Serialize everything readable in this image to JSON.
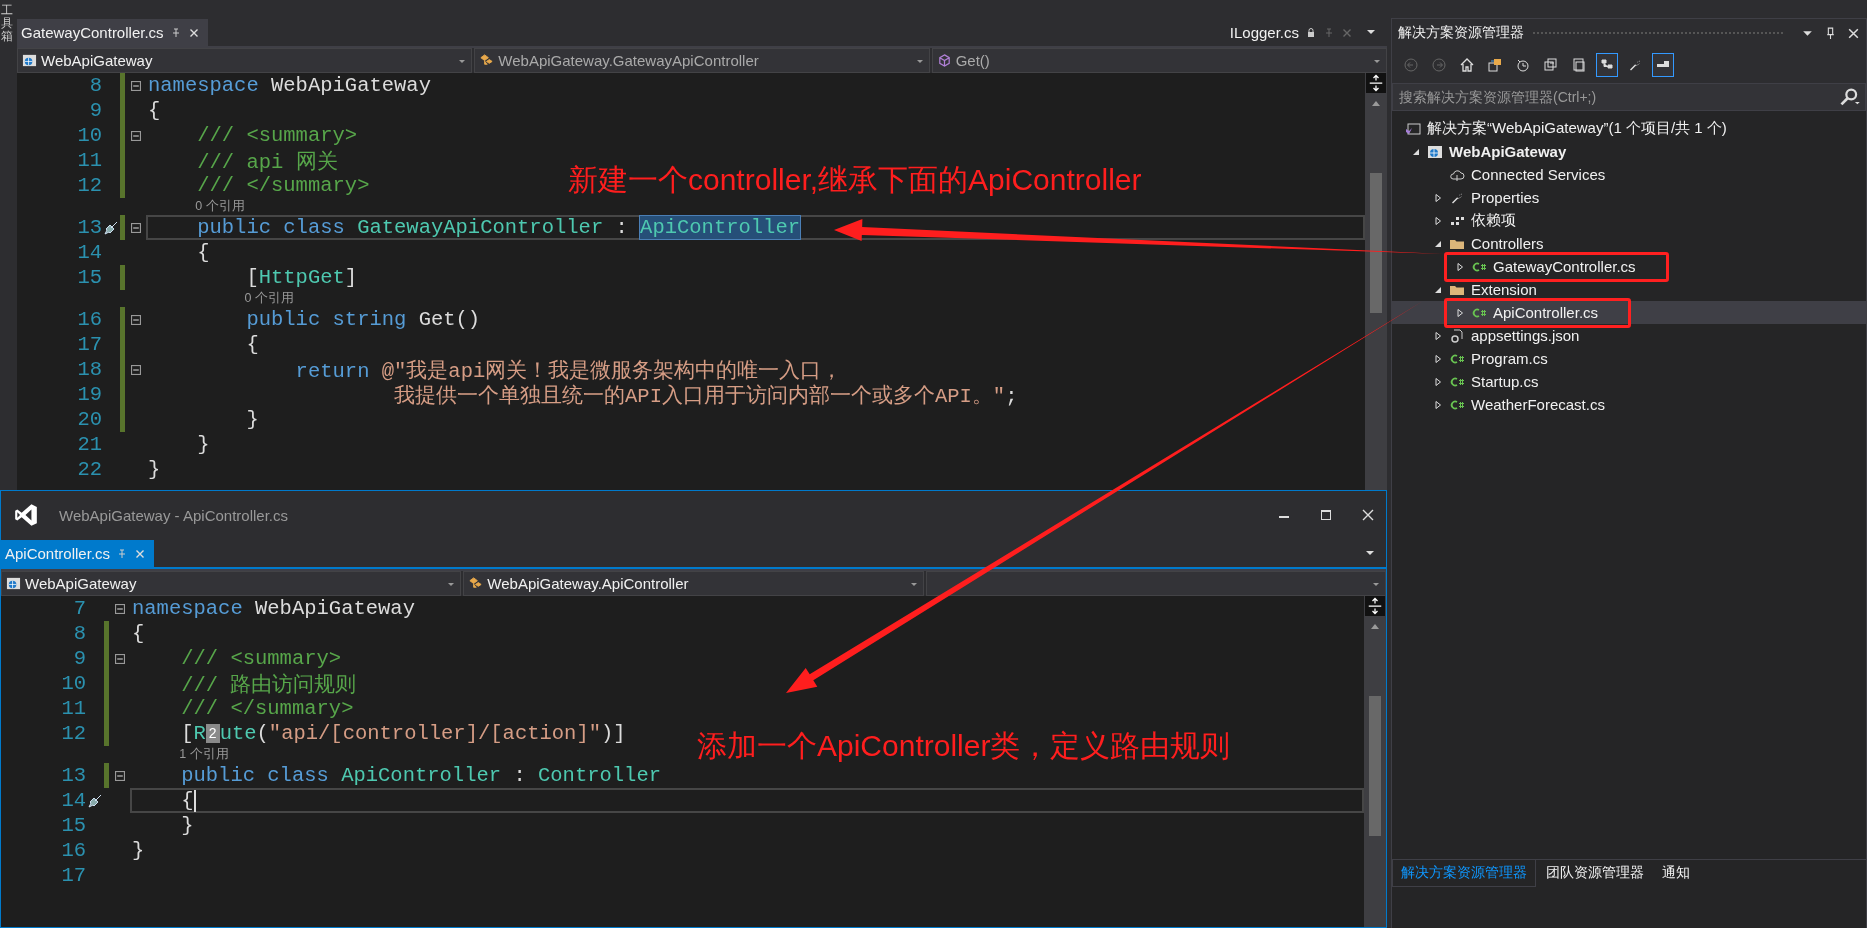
{
  "toolbox_tab": "工具箱",
  "editor": {
    "active": false,
    "tabs": [
      {
        "label": "GatewayController.cs",
        "selected": true
      }
    ],
    "side_tab": {
      "label": "ILogger.cs"
    },
    "nav": [
      {
        "kind": "project",
        "text": "WebApiGateway"
      },
      {
        "kind": "class",
        "text": "WebApiGateway.GatewayApiController"
      },
      {
        "kind": "method",
        "text": "Get()"
      }
    ],
    "lines": [
      {
        "kind": "code",
        "number": "8",
        "fold": true,
        "changed": true,
        "current": false,
        "tokens": [
          {
            "kind": "keyword",
            "text": "namespace"
          },
          {
            "kind": "plain",
            "text": " WebApiGateway"
          }
        ]
      },
      {
        "kind": "code",
        "number": "9",
        "changed": true,
        "current": false,
        "tokens": [
          {
            "kind": "plain",
            "text": "{"
          }
        ]
      },
      {
        "kind": "code",
        "number": "10",
        "fold": true,
        "changed": true,
        "current": false,
        "tokens": [
          {
            "kind": "comment",
            "text": "    /// <summary>"
          }
        ]
      },
      {
        "kind": "code",
        "number": "11",
        "changed": true,
        "current": false,
        "tokens": [
          {
            "kind": "comment",
            "text": "    /// api 网关"
          }
        ]
      },
      {
        "kind": "code",
        "number": "12",
        "changed": true,
        "current": false,
        "tokens": [
          {
            "kind": "comment",
            "text": "    /// </summary>"
          }
        ]
      },
      {
        "kind": "codelens",
        "text": "0 个引用"
      },
      {
        "kind": "code",
        "number": "13",
        "fold": true,
        "changed": true,
        "current": true,
        "quick_action": true,
        "tokens": [
          {
            "kind": "keyword",
            "text": "    public class "
          },
          {
            "kind": "type",
            "text": "GatewayApiController"
          },
          {
            "kind": "plain",
            "text": " : "
          },
          {
            "kind": "type-selected",
            "text": "ApiController"
          }
        ]
      },
      {
        "kind": "code",
        "number": "14",
        "changed": false,
        "current": false,
        "tokens": [
          {
            "kind": "plain",
            "text": "    {"
          }
        ]
      },
      {
        "kind": "code",
        "number": "15",
        "changed": true,
        "current": false,
        "tokens": [
          {
            "kind": "plain",
            "text": "        ["
          },
          {
            "kind": "type",
            "text": "HttpGet"
          },
          {
            "kind": "plain",
            "text": "]"
          }
        ]
      },
      {
        "kind": "codelens",
        "text": "0 个引用"
      },
      {
        "kind": "code",
        "number": "16",
        "fold": true,
        "changed": true,
        "current": false,
        "tokens": [
          {
            "kind": "keyword",
            "text": "        public string "
          },
          {
            "kind": "plain",
            "text": "Get()"
          }
        ]
      },
      {
        "kind": "code",
        "number": "17",
        "changed": true,
        "current": false,
        "tokens": [
          {
            "kind": "plain",
            "text": "        {"
          }
        ]
      },
      {
        "kind": "code",
        "number": "18",
        "fold": true,
        "changed": true,
        "current": false,
        "tokens": [
          {
            "kind": "keyword",
            "text": "            return "
          },
          {
            "kind": "string",
            "text": "@\"我是api网关！我是微服务架构中的唯一入口，"
          }
        ]
      },
      {
        "kind": "code",
        "number": "19",
        "changed": true,
        "current": false,
        "tokens": [
          {
            "kind": "string",
            "text": "                    我提供一个单独且统一的API入口用于访问内部一个或多个API。\""
          },
          {
            "kind": "plain",
            "text": ";"
          }
        ]
      },
      {
        "kind": "code",
        "number": "20",
        "changed": true,
        "current": false,
        "tokens": [
          {
            "kind": "plain",
            "text": "        }"
          }
        ]
      },
      {
        "kind": "code",
        "number": "21",
        "changed": false,
        "current": false,
        "tokens": [
          {
            "kind": "plain",
            "text": "    }"
          }
        ]
      },
      {
        "kind": "code",
        "number": "22",
        "changed": false,
        "current": false,
        "tokens": [
          {
            "kind": "plain",
            "text": "}"
          }
        ]
      }
    ]
  },
  "floating_window": {
    "title": "WebApiGateway - ApiController.cs",
    "active": true,
    "tabs": [
      {
        "label": "ApiController.cs",
        "selected": true
      }
    ],
    "nav": [
      {
        "kind": "project",
        "text": "WebApiGateway"
      },
      {
        "kind": "class",
        "text": "WebApiGateway.ApiController"
      }
    ],
    "lines": [
      {
        "kind": "code",
        "number": "7",
        "fold": true,
        "changed": false,
        "current": false,
        "tokens": [
          {
            "kind": "keyword",
            "text": "namespace"
          },
          {
            "kind": "plain",
            "text": " WebApiGateway"
          }
        ]
      },
      {
        "kind": "code",
        "number": "8",
        "changed": true,
        "current": false,
        "tokens": [
          {
            "kind": "plain",
            "text": "{"
          }
        ]
      },
      {
        "kind": "code",
        "number": "9",
        "fold": true,
        "changed": true,
        "current": false,
        "tokens": [
          {
            "kind": "comment",
            "text": "    /// <summary>"
          }
        ]
      },
      {
        "kind": "code",
        "number": "10",
        "changed": true,
        "current": false,
        "tokens": [
          {
            "kind": "comment",
            "text": "    /// 路由访问规则"
          }
        ]
      },
      {
        "kind": "code",
        "number": "11",
        "changed": true,
        "current": false,
        "tokens": [
          {
            "kind": "comment",
            "text": "    /// </summary>"
          }
        ]
      },
      {
        "kind": "code",
        "number": "12",
        "changed": true,
        "current": false,
        "tokens": [
          {
            "kind": "plain",
            "text": "    ["
          },
          {
            "kind": "type",
            "text": "R"
          },
          {
            "kind": "badge",
            "text": "2"
          },
          {
            "kind": "type",
            "text": "ute"
          },
          {
            "kind": "plain",
            "text": "("
          },
          {
            "kind": "string",
            "text": "\"api/[controller]/[action]\""
          },
          {
            "kind": "plain",
            "text": ")]"
          }
        ]
      },
      {
        "kind": "codelens",
        "text": "1 个引用"
      },
      {
        "kind": "code",
        "number": "13",
        "fold": true,
        "changed": true,
        "current": false,
        "tokens": [
          {
            "kind": "keyword",
            "text": "    public class "
          },
          {
            "kind": "type",
            "text": "ApiController"
          },
          {
            "kind": "plain",
            "text": " : "
          },
          {
            "kind": "type",
            "text": "Controller"
          }
        ]
      },
      {
        "kind": "code",
        "number": "14",
        "changed": false,
        "current": true,
        "quick_action": true,
        "tokens": [
          {
            "kind": "plain",
            "text": "    {"
          }
        ]
      },
      {
        "kind": "code",
        "number": "15",
        "changed": false,
        "current": false,
        "tokens": [
          {
            "kind": "plain",
            "text": "    }"
          }
        ]
      },
      {
        "kind": "code",
        "number": "16",
        "changed": false,
        "current": false,
        "tokens": [
          {
            "kind": "plain",
            "text": "}"
          }
        ]
      },
      {
        "kind": "code",
        "number": "17",
        "changed": false,
        "current": false
      }
    ]
  },
  "solution_explorer": {
    "title": "解决方案资源管理器",
    "toolbar": [
      {
        "kind": "back",
        "on": false
      },
      {
        "kind": "forward",
        "on": false
      },
      {
        "kind": "home",
        "on": false
      },
      {
        "kind": "sync",
        "on": false
      },
      {
        "kind": "history",
        "on": false
      },
      {
        "kind": "collapse",
        "on": false
      },
      {
        "kind": "copy",
        "on": false
      },
      {
        "kind": "tree",
        "on": true
      },
      {
        "kind": "wrench",
        "on": false
      },
      {
        "kind": "preview",
        "on": true
      }
    ],
    "search": {
      "placeholder": "搜索解决方案资源管理器(Ctrl+;)"
    },
    "tree": [
      {
        "label": "解决方案“WebApiGateway”(1 个项目/共 1 个)",
        "kind": "solution",
        "selected": false,
        "marked": false,
        "children": [
          {
            "label": "WebApiGateway",
            "kind": "project",
            "expanded": true,
            "selected": false,
            "marked": false,
            "children": [
              {
                "label": "Connected Services",
                "kind": "cloud",
                "selected": false,
                "marked": false
              },
              {
                "label": "Properties",
                "kind": "wrench",
                "expanded": false,
                "selected": false,
                "marked": false
              },
              {
                "label": "依赖项",
                "kind": "deps",
                "expanded": false,
                "selected": false,
                "marked": false
              },
              {
                "label": "Controllers",
                "kind": "folder",
                "expanded": true,
                "selected": false,
                "marked": false,
                "children": [
                  {
                    "label": "GatewayController.cs",
                    "kind": "cs",
                    "expanded": false,
                    "selected": false,
                    "marked": true
                  }
                ]
              },
              {
                "label": "Extension",
                "kind": "folder",
                "expanded": true,
                "selected": false,
                "marked": false,
                "children": [
                  {
                    "label": "ApiController.cs",
                    "kind": "cs",
                    "expanded": false,
                    "selected": true,
                    "marked": true
                  }
                ]
              },
              {
                "label": "appsettings.json",
                "kind": "json",
                "expanded": false,
                "selected": false,
                "marked": false
              },
              {
                "label": "Program.cs",
                "kind": "cs",
                "expanded": false,
                "selected": false,
                "marked": false
              },
              {
                "label": "Startup.cs",
                "kind": "cs",
                "expanded": false,
                "selected": false,
                "marked": false
              },
              {
                "label": "WeatherForecast.cs",
                "kind": "cs",
                "expanded": false,
                "selected": false,
                "marked": false
              }
            ]
          }
        ]
      }
    ],
    "bottom_tabs": [
      {
        "label": "解决方案资源管理器",
        "selected": true
      },
      {
        "label": "团队资源管理器",
        "selected": false
      },
      {
        "label": "通知",
        "selected": false
      }
    ]
  },
  "annotations": [
    {
      "text": "新建一个controller,继承下面的ApiController"
    },
    {
      "text": "添加一个ApiController类，定义路由规则"
    }
  ]
}
